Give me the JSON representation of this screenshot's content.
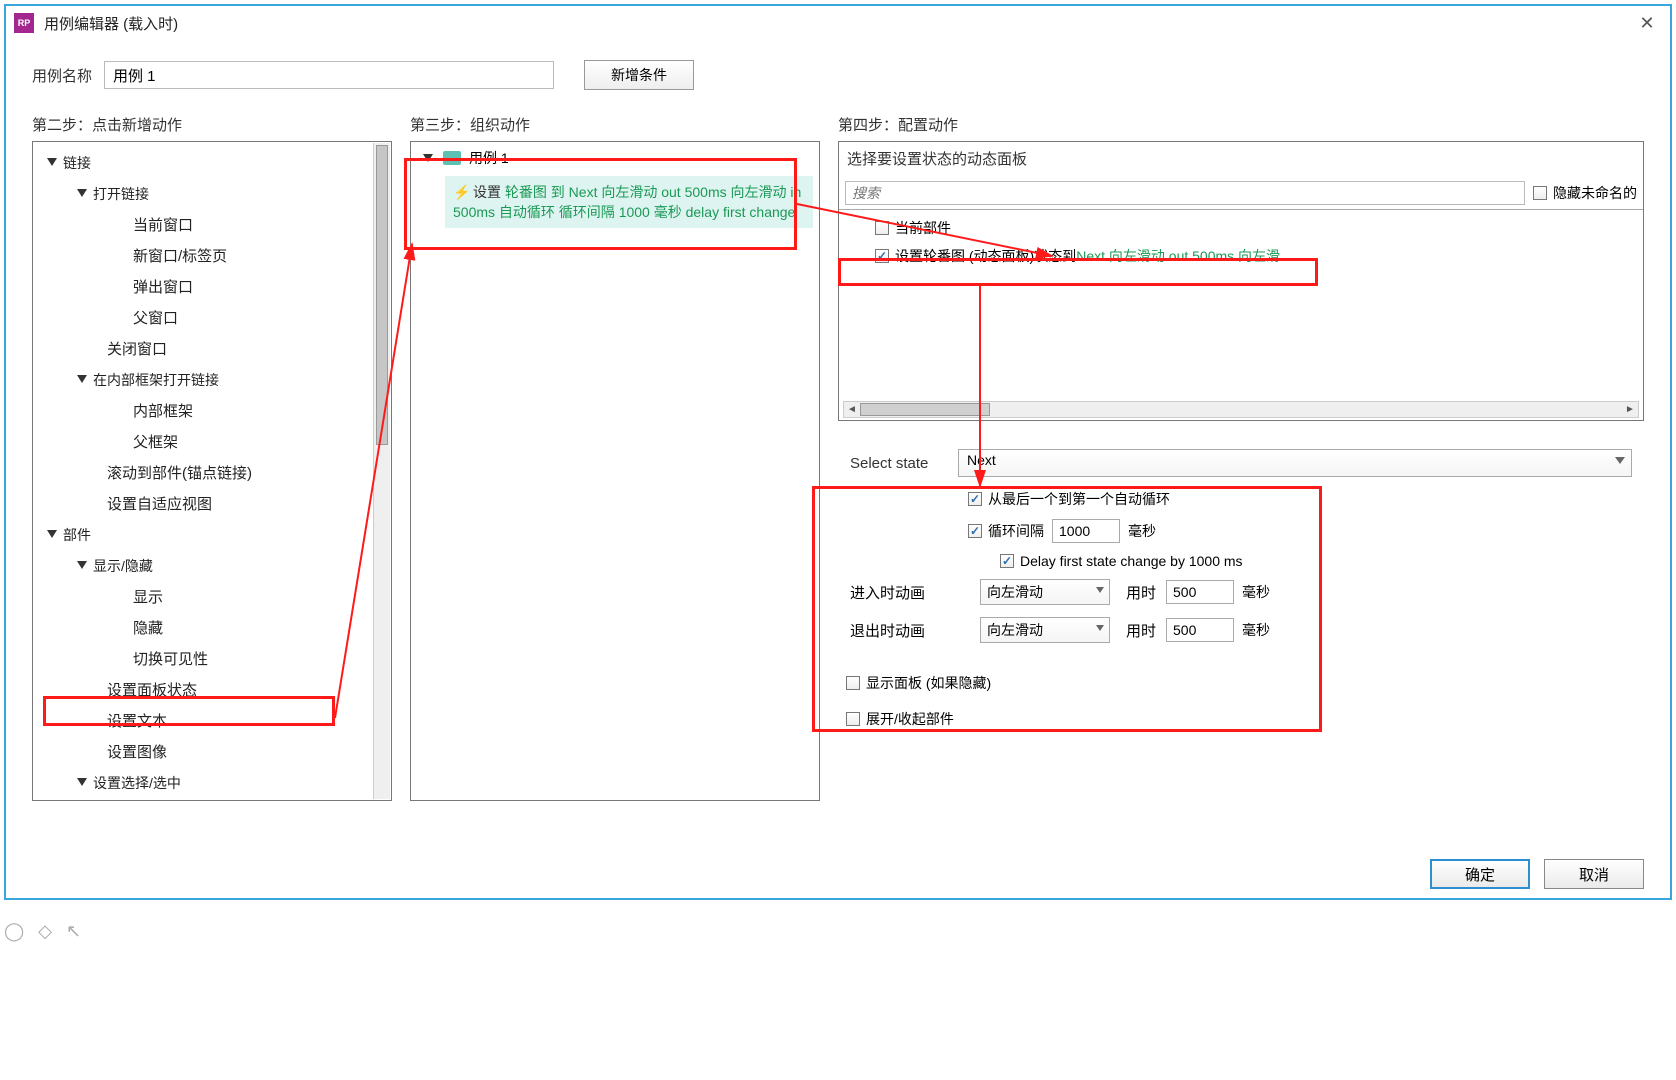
{
  "window": {
    "title": "用例编辑器 (载入时)",
    "app_icon_text": "RP"
  },
  "name_row": {
    "label": "用例名称",
    "value": "用例 1",
    "add_condition": "新增条件"
  },
  "steps": {
    "step2": "第二步：点击新增动作",
    "step3": "第三步：组织动作",
    "step4": "第四步：配置动作"
  },
  "tree": {
    "links": "链接",
    "open_link": "打开链接",
    "current_window": "当前窗口",
    "new_window_tab": "新窗口/标签页",
    "popup_window": "弹出窗口",
    "parent_window": "父窗口",
    "close_window": "关闭窗口",
    "open_in_frame": "在内部框架打开链接",
    "inner_frame": "内部框架",
    "parent_frame": "父框架",
    "scroll_to_widget": "滚动到部件(锚点链接)",
    "set_adaptive_view": "设置自适应视图",
    "widgets": "部件",
    "show_hide": "显示/隐藏",
    "show": "显示",
    "hide": "隐藏",
    "toggle_visibility": "切换可见性",
    "set_panel_state": "设置面板状态",
    "set_text": "设置文本",
    "set_image": "设置图像",
    "set_selected_checked": "设置选择/选中"
  },
  "step3_body": {
    "case_label": "用例 1",
    "action_prefix": "设置 ",
    "action_green": "轮番图 到 Next 向左滑动 out 500ms 向左滑动 in 500ms 自动循环 循环间隔 1000 毫秒 delay first change"
  },
  "step4_body": {
    "panel_heading": "选择要设置状态的动态面板",
    "search_placeholder": "搜索",
    "hide_unnamed": "隐藏未命名的",
    "current_widget": "当前部件",
    "row2_prefix": "设置轮番图 (动态面板)状态到 ",
    "row2_green": "Next 向左滑动 out 500ms 向左滑",
    "select_state_label": "Select state",
    "select_state_value": "Next",
    "wrap_label": "从最后一个到第一个自动循环",
    "repeat_every_label": "循环间隔",
    "repeat_value": "1000",
    "repeat_unit": "毫秒",
    "delay_label": "Delay first state change by 1000 ms",
    "anim_in_label": "进入时动画",
    "anim_out_label": "退出时动画",
    "slide_left": "向左滑动",
    "time_label": "用时",
    "time_in": "500",
    "time_out": "500",
    "time_unit": "毫秒",
    "show_if_hidden": "显示面板 (如果隐藏)",
    "expand_collapse": "展开/收起部件"
  },
  "footer": {
    "ok": "确定",
    "cancel": "取消"
  }
}
